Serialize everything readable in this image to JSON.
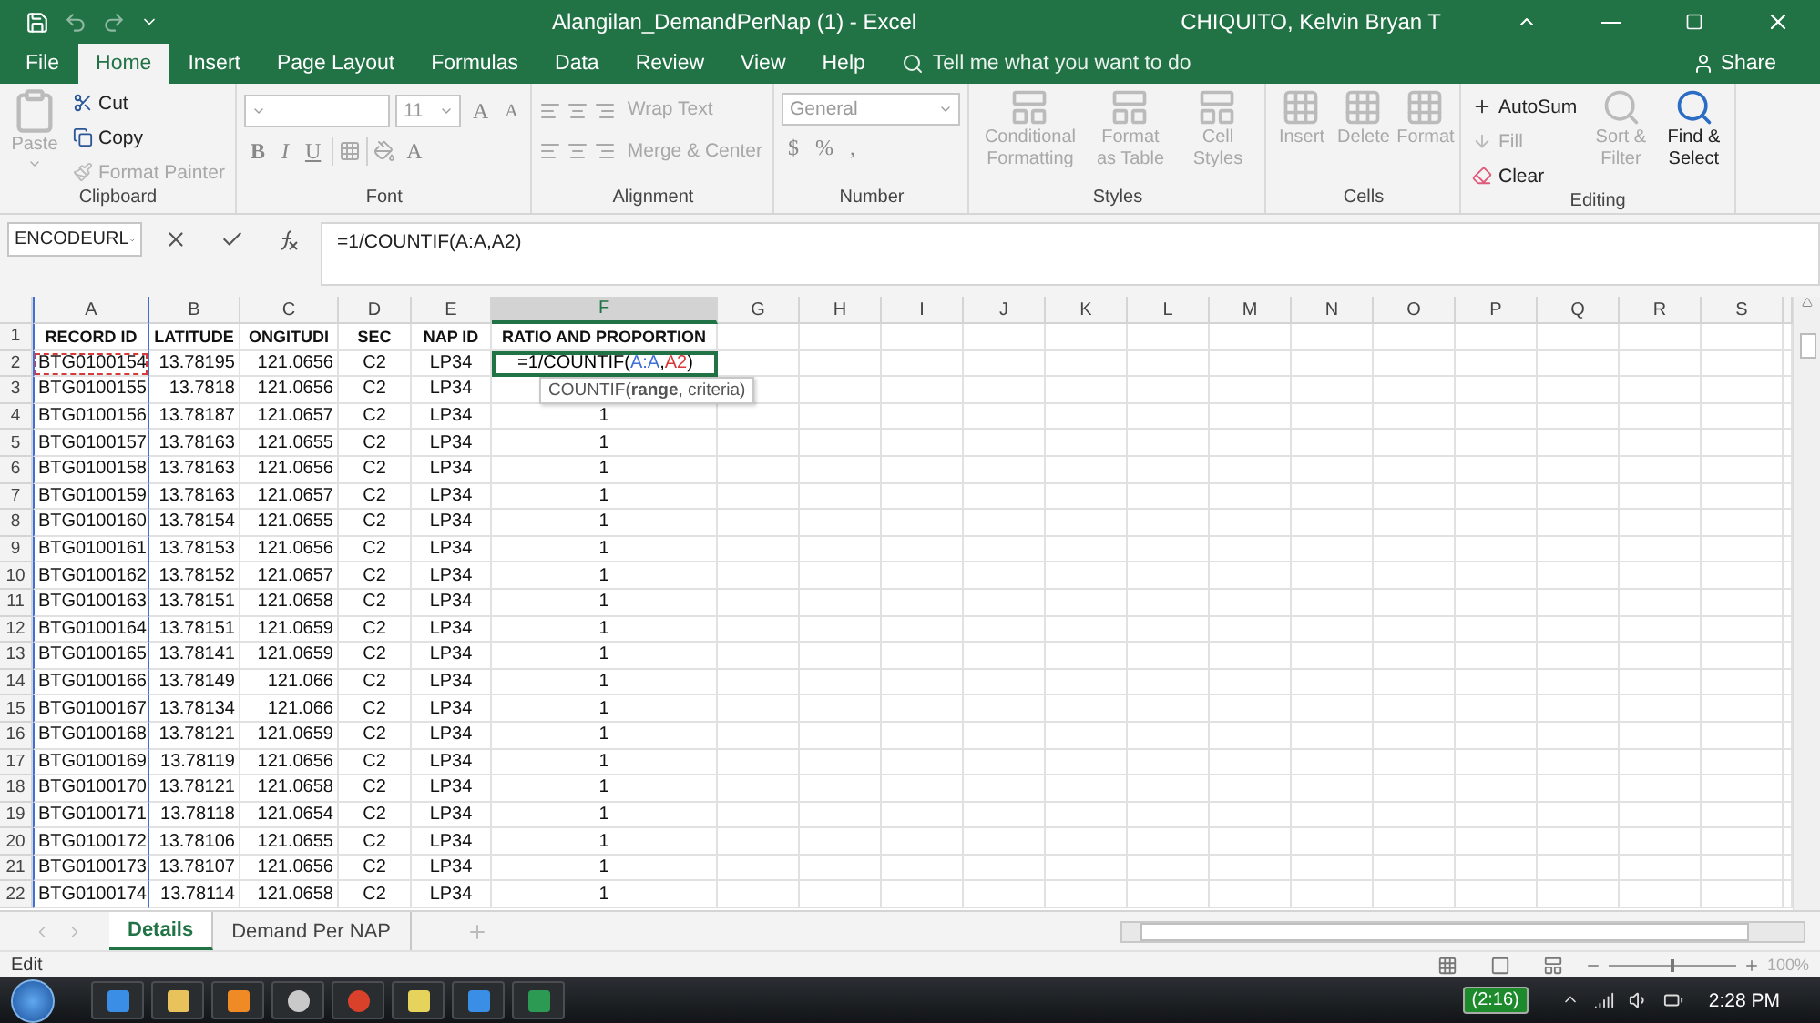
{
  "window": {
    "title": "Alangilan_DemandPerNap (1)  -  Excel",
    "user": "CHIQUITO, Kelvin Bryan T"
  },
  "ribbon_tabs": [
    {
      "label": "File",
      "selected": false
    },
    {
      "label": "Home",
      "selected": true
    },
    {
      "label": "Insert",
      "selected": false
    },
    {
      "label": "Page Layout",
      "selected": false
    },
    {
      "label": "Formulas",
      "selected": false
    },
    {
      "label": "Data",
      "selected": false
    },
    {
      "label": "Review",
      "selected": false
    },
    {
      "label": "View",
      "selected": false
    },
    {
      "label": "Help",
      "selected": false
    }
  ],
  "tell_me": {
    "placeholder": "Tell me what you want to do"
  },
  "share": "Share",
  "ribbon_groups": [
    {
      "kind": "clipboard",
      "label": "Clipboard",
      "paste": {
        "label": "Paste",
        "disabled": true
      },
      "items": [
        {
          "label": "Cut",
          "disabled": false
        },
        {
          "label": "Copy",
          "disabled": false
        },
        {
          "label": "Format Painter",
          "disabled": true
        }
      ]
    },
    {
      "kind": "font",
      "label": "Font",
      "size": "11",
      "grow": "A",
      "shrink": "A",
      "bold": "B",
      "italic": "I",
      "underline": "U",
      "font_color": "A"
    },
    {
      "kind": "alignment",
      "label": "Alignment",
      "wrap": "Wrap Text",
      "merge": "Merge & Center"
    },
    {
      "kind": "number",
      "label": "Number",
      "format": "General",
      "currency": "$",
      "percent": "%",
      "comma": ","
    },
    {
      "kind": "styles",
      "label": "Styles",
      "buttons": [
        "Conditional Formatting",
        "Format as Table",
        "Cell Styles"
      ]
    },
    {
      "kind": "cells",
      "label": "Cells",
      "buttons": [
        "Insert",
        "Delete",
        "Format"
      ]
    },
    {
      "kind": "editing",
      "label": "Editing",
      "items": [
        {
          "label": "AutoSum",
          "disabled": false
        },
        {
          "label": "Fill",
          "disabled": true
        },
        {
          "label": "Clear",
          "disabled": false
        }
      ],
      "buttons": [
        {
          "label": "Sort & Filter",
          "disabled": true
        },
        {
          "label": "Find & Select",
          "disabled": false
        }
      ]
    }
  ],
  "formula_bar": {
    "name_box": "ENCODEURL",
    "formula": "=1/COUNTIF(A:A,A2)"
  },
  "columns": [
    {
      "label": "A",
      "selected": false,
      "referenced": true
    },
    {
      "label": "B",
      "selected": false,
      "referenced": false
    },
    {
      "label": "C",
      "selected": false,
      "referenced": false
    },
    {
      "label": "D",
      "selected": false,
      "referenced": false
    },
    {
      "label": "E",
      "selected": false,
      "referenced": false
    },
    {
      "label": "F",
      "selected": true,
      "referenced": false
    },
    {
      "label": "G",
      "selected": false,
      "referenced": false
    },
    {
      "label": "H",
      "selected": false,
      "referenced": false
    },
    {
      "label": "I",
      "selected": false,
      "referenced": false
    },
    {
      "label": "J",
      "selected": false,
      "referenced": false
    },
    {
      "label": "K",
      "selected": false,
      "referenced": false
    },
    {
      "label": "L",
      "selected": false,
      "referenced": false
    },
    {
      "label": "M",
      "selected": false,
      "referenced": false
    },
    {
      "label": "N",
      "selected": false,
      "referenced": false
    },
    {
      "label": "O",
      "selected": false,
      "referenced": false
    },
    {
      "label": "P",
      "selected": false,
      "referenced": false
    },
    {
      "label": "Q",
      "selected": false,
      "referenced": false
    },
    {
      "label": "R",
      "selected": false,
      "referenced": false
    },
    {
      "label": "S",
      "selected": false,
      "referenced": false
    }
  ],
  "rows": [
    {
      "number": "1",
      "kind": "header",
      "referenced": false,
      "cells": [
        "RECORD ID",
        "LATITUDE",
        "ONGITUDI",
        "SEC",
        "NAP ID",
        "RATIO AND PROPORTION"
      ]
    },
    {
      "number": "2",
      "kind": "editing",
      "referenced": true,
      "cells": [
        "BTG0100154",
        "13.78195",
        "121.0656",
        "C2",
        "LP34"
      ],
      "editing_cell": [
        {
          "text": "=1/COUNTIF("
        },
        {
          "text": "A:A",
          "color": "#3f6fd8"
        },
        {
          "text": ","
        },
        {
          "text": "A2",
          "color": "#d83a3a"
        },
        {
          "text": ")"
        }
      ]
    },
    {
      "number": "3",
      "kind": "data",
      "referenced": false,
      "cells": [
        "BTG0100155",
        "13.7818",
        "121.0656",
        "C2",
        "LP34"
      ]
    },
    {
      "number": "4",
      "kind": "data",
      "referenced": false,
      "cells": [
        "BTG0100156",
        "13.78187",
        "121.0657",
        "C2",
        "LP34",
        "1"
      ]
    },
    {
      "number": "5",
      "kind": "data",
      "referenced": false,
      "cells": [
        "BTG0100157",
        "13.78163",
        "121.0655",
        "C2",
        "LP34",
        "1"
      ]
    },
    {
      "number": "6",
      "kind": "data",
      "referenced": false,
      "cells": [
        "BTG0100158",
        "13.78163",
        "121.0656",
        "C2",
        "LP34",
        "1"
      ]
    },
    {
      "number": "7",
      "kind": "data",
      "referenced": false,
      "cells": [
        "BTG0100159",
        "13.78163",
        "121.0657",
        "C2",
        "LP34",
        "1"
      ]
    },
    {
      "number": "8",
      "kind": "data",
      "referenced": false,
      "cells": [
        "BTG0100160",
        "13.78154",
        "121.0655",
        "C2",
        "LP34",
        "1"
      ]
    },
    {
      "number": "9",
      "kind": "data",
      "referenced": false,
      "cells": [
        "BTG0100161",
        "13.78153",
        "121.0656",
        "C2",
        "LP34",
        "1"
      ]
    },
    {
      "number": "10",
      "kind": "data",
      "referenced": false,
      "cells": [
        "BTG0100162",
        "13.78152",
        "121.0657",
        "C2",
        "LP34",
        "1"
      ]
    },
    {
      "number": "11",
      "kind": "data",
      "referenced": false,
      "cells": [
        "BTG0100163",
        "13.78151",
        "121.0658",
        "C2",
        "LP34",
        "1"
      ]
    },
    {
      "number": "12",
      "kind": "data",
      "referenced": false,
      "cells": [
        "BTG0100164",
        "13.78151",
        "121.0659",
        "C2",
        "LP34",
        "1"
      ]
    },
    {
      "number": "13",
      "kind": "data",
      "referenced": false,
      "cells": [
        "BTG0100165",
        "13.78141",
        "121.0659",
        "C2",
        "LP34",
        "1"
      ]
    },
    {
      "number": "14",
      "kind": "data",
      "referenced": false,
      "cells": [
        "BTG0100166",
        "13.78149",
        "121.066",
        "C2",
        "LP34",
        "1"
      ]
    },
    {
      "number": "15",
      "kind": "data",
      "referenced": false,
      "cells": [
        "BTG0100167",
        "13.78134",
        "121.066",
        "C2",
        "LP34",
        "1"
      ]
    },
    {
      "number": "16",
      "kind": "data",
      "referenced": false,
      "cells": [
        "BTG0100168",
        "13.78121",
        "121.0659",
        "C2",
        "LP34",
        "1"
      ]
    },
    {
      "number": "17",
      "kind": "data",
      "referenced": false,
      "cells": [
        "BTG0100169",
        "13.78119",
        "121.0656",
        "C2",
        "LP34",
        "1"
      ]
    },
    {
      "number": "18",
      "kind": "data",
      "referenced": false,
      "cells": [
        "BTG0100170",
        "13.78121",
        "121.0658",
        "C2",
        "LP34",
        "1"
      ]
    },
    {
      "number": "19",
      "kind": "data",
      "referenced": false,
      "cells": [
        "BTG0100171",
        "13.78118",
        "121.0654",
        "C2",
        "LP34",
        "1"
      ]
    },
    {
      "number": "20",
      "kind": "data",
      "referenced": false,
      "cells": [
        "BTG0100172",
        "13.78106",
        "121.0655",
        "C2",
        "LP34",
        "1"
      ]
    },
    {
      "number": "21",
      "kind": "data",
      "referenced": false,
      "cells": [
        "BTG0100173",
        "13.78107",
        "121.0656",
        "C2",
        "LP34",
        "1"
      ]
    },
    {
      "number": "22",
      "kind": "data",
      "referenced": false,
      "cells": [
        "BTG0100174",
        "13.78114",
        "121.0658",
        "C2",
        "LP34",
        "1"
      ]
    }
  ],
  "tooltip": "COUNTIF(**range**, criteria)",
  "sheet_tabs": [
    {
      "label": "Details",
      "selected": true
    },
    {
      "label": "Demand Per NAP",
      "selected": false
    }
  ],
  "status_bar": {
    "mode": "Edit",
    "zoom": "100%",
    "zoom_slider": {
      "level": 0.5
    }
  },
  "taskbar": {
    "battery": "(2:16)",
    "clock": "2:28 PM"
  }
}
